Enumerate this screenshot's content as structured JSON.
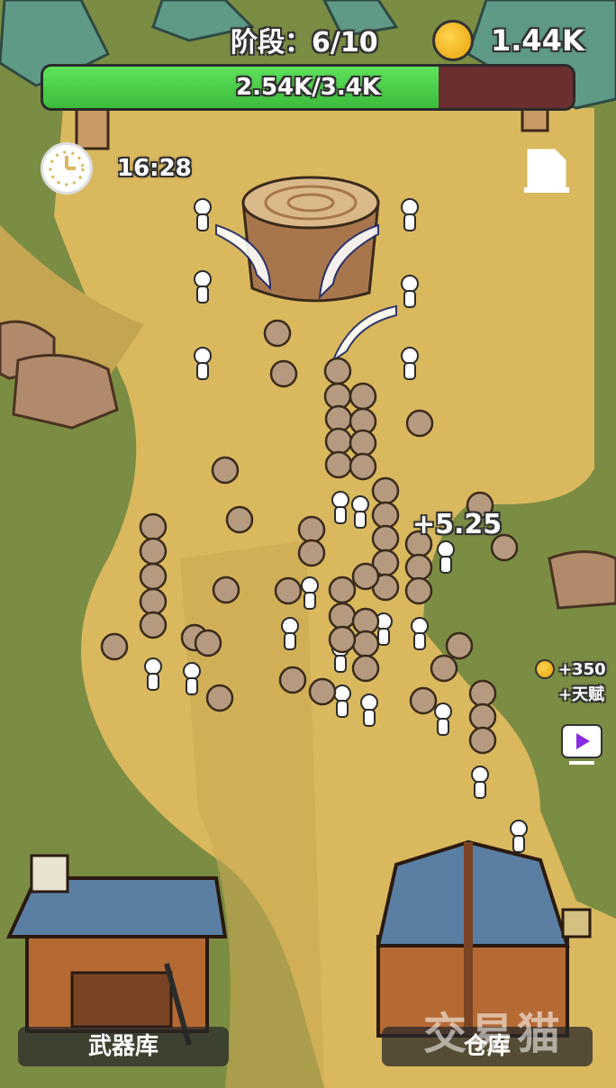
{
  "hud": {
    "stage_label": "阶段：6/10",
    "gold_amount": "1.44K",
    "progress_text": "2.54K/3.4K",
    "progress_fraction": 0.747,
    "timer": "16:28"
  },
  "popups": {
    "gain": "+5.25",
    "reward_gold": "+350",
    "reward_talent": "+天赋"
  },
  "buildings": {
    "armory_label": "武器库",
    "warehouse_label": "仓库"
  },
  "watermark": "交易猫",
  "colors": {
    "path": "#d9b85e",
    "grass": "#7b8c43",
    "progress_fill": "#4fd04c",
    "progress_empty": "#6b2f2f",
    "roof": "#5a7fa3",
    "wood": "#b56a34"
  },
  "icons": [
    "gold-coin-icon",
    "clock-icon",
    "document-icon",
    "video-play-icon"
  ]
}
